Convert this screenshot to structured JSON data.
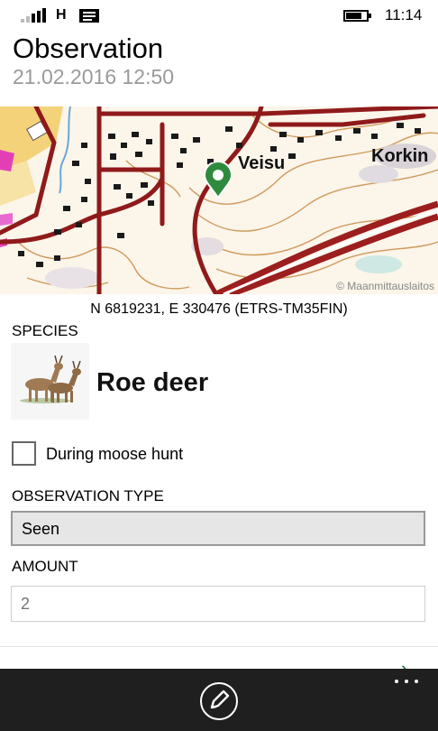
{
  "status_bar": {
    "network_type": "H",
    "time": "11:14",
    "icons": [
      "signal-icon",
      "message-icon",
      "battery-icon"
    ]
  },
  "header": {
    "title": "Observation",
    "datetime": "21.02.2016 12:50"
  },
  "map": {
    "place_labels": [
      "Veisu",
      "Korkin"
    ],
    "copyright": "© Maanmittauslaitos",
    "marker_icon": "location-pin-icon",
    "marker_color": "#2e8b3e"
  },
  "coordinates": "N 6819231, E 330476 (ETRS-TM35FIN)",
  "species": {
    "label": "SPECIES",
    "name": "Roe deer",
    "image_icon": "roe-deer-image"
  },
  "moose_hunt": {
    "label": "During moose hunt",
    "checked": false
  },
  "observation_type": {
    "label": "OBSERVATION TYPE",
    "value": "Seen"
  },
  "amount": {
    "label": "AMOUNT",
    "placeholder": "2"
  },
  "app_bar": {
    "edit_icon": "edit-icon",
    "more_icon": "more-icon",
    "next_icon": "chevron-right-icon"
  }
}
